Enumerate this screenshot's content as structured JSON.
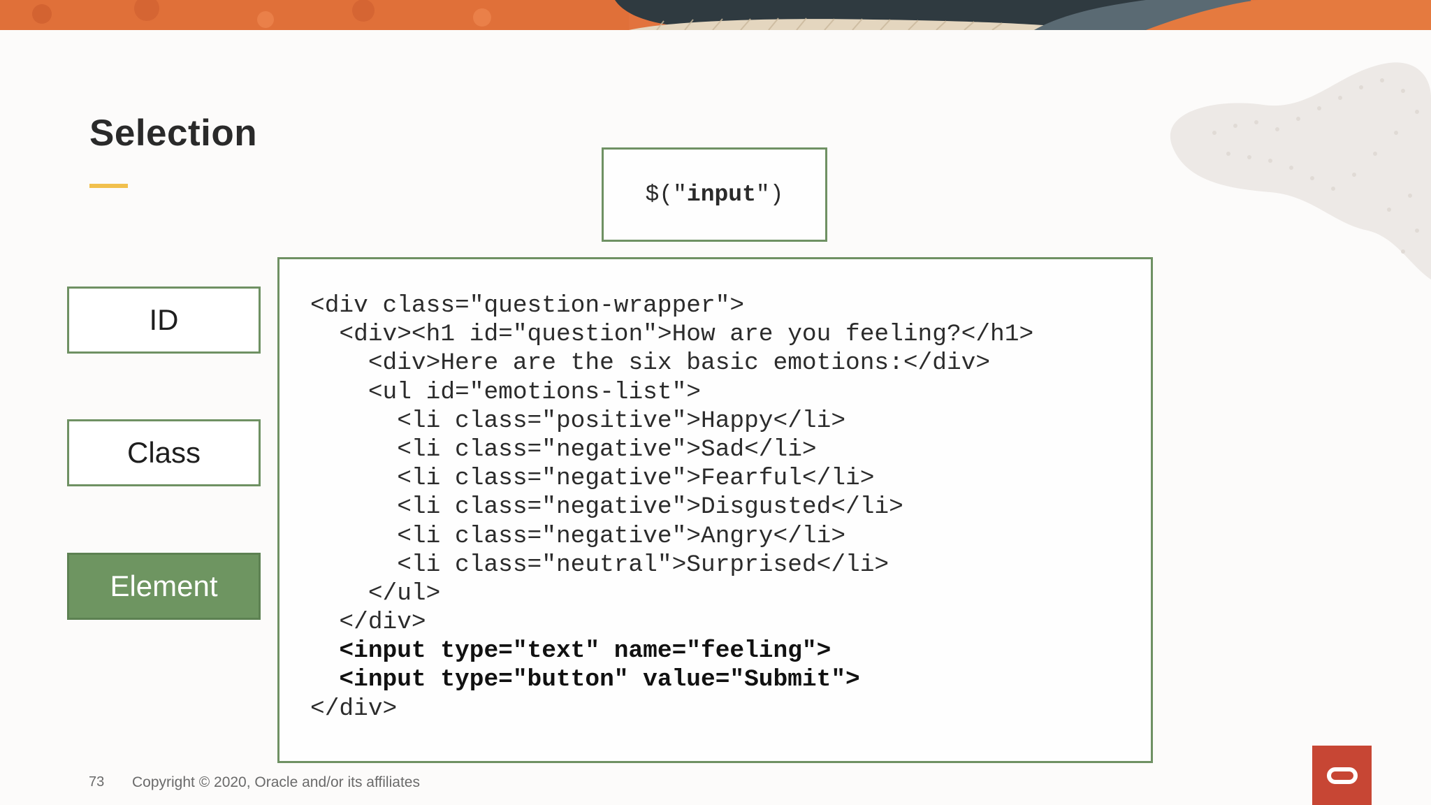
{
  "slide": {
    "title": "Selection",
    "selector_code_prefix": "$(\"",
    "selector_code_value": "input",
    "selector_code_suffix": "\")",
    "categories": [
      {
        "label": "ID",
        "active": false
      },
      {
        "label": "Class",
        "active": false
      },
      {
        "label": "Element",
        "active": true
      }
    ],
    "code_lines": [
      {
        "text": "<div class=\"question-wrapper\">",
        "bold": false
      },
      {
        "text": "  <div><h1 id=\"question\">How are you feeling?</h1>",
        "bold": false
      },
      {
        "text": "    <div>Here are the six basic emotions:</div>",
        "bold": false
      },
      {
        "text": "    <ul id=\"emotions-list\">",
        "bold": false
      },
      {
        "text": "      <li class=\"positive\">Happy</li>",
        "bold": false
      },
      {
        "text": "      <li class=\"negative\">Sad</li>",
        "bold": false
      },
      {
        "text": "      <li class=\"negative\">Fearful</li>",
        "bold": false
      },
      {
        "text": "      <li class=\"negative\">Disgusted</li>",
        "bold": false
      },
      {
        "text": "      <li class=\"negative\">Angry</li>",
        "bold": false
      },
      {
        "text": "      <li class=\"neutral\">Surprised</li>",
        "bold": false
      },
      {
        "text": "    </ul>",
        "bold": false
      },
      {
        "text": "  </div>",
        "bold": false
      },
      {
        "text": "  <input type=\"text\" name=\"feeling\">",
        "bold": true
      },
      {
        "text": "  <input type=\"button\" value=\"Submit\">",
        "bold": true
      },
      {
        "text": "</div>",
        "bold": false
      }
    ]
  },
  "footer": {
    "page_number": "73",
    "copyright": "Copyright © 2020, Oracle and/or its affiliates"
  },
  "colors": {
    "accent_green": "#6e9561",
    "border_green": "#6f9163",
    "title_underline": "#f1c04d",
    "oracle_red": "#c74634",
    "banner_orange": "#e2733d"
  },
  "icons": {
    "logo": "oracle-logo-icon"
  }
}
